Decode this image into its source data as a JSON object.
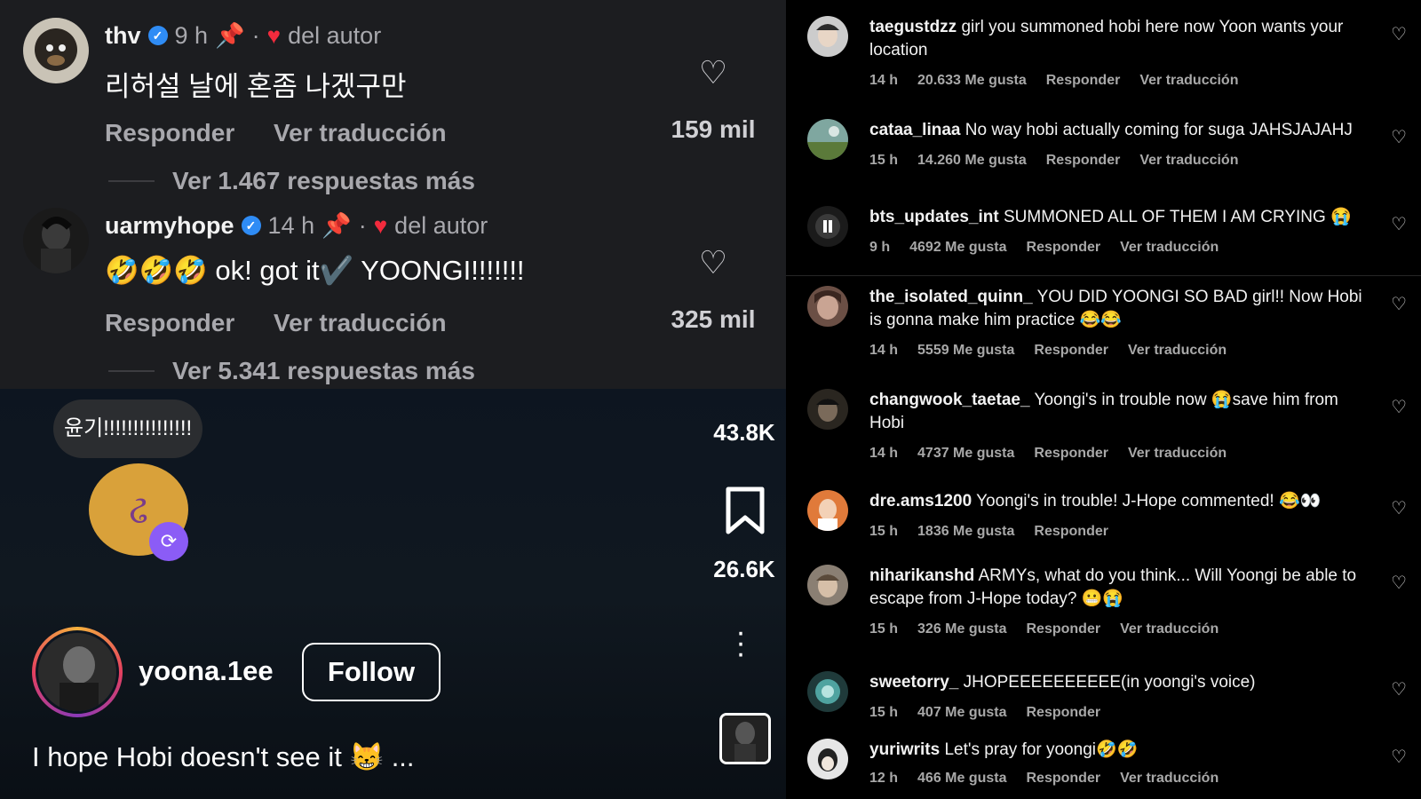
{
  "left_panel": {
    "comments": [
      {
        "username": "thv",
        "time": "9 h",
        "by_author": "del autor",
        "text": "리허설 날에 혼좀 나겠구만",
        "reply": "Responder",
        "translate": "Ver traducción",
        "likes": "159 mil",
        "more_replies": "Ver 1.467 respuestas más"
      },
      {
        "username": "uarmyhope",
        "time": "14 h",
        "by_author": "del autor",
        "text": "🤣🤣🤣 ok! got it✔️ YOONGI!!!!!!!",
        "reply": "Responder",
        "translate": "Ver traducción",
        "likes": "325 mil",
        "more_replies": "Ver 5.341 respuestas más"
      }
    ],
    "video": {
      "bubble_text": "윤기!!!!!!!!!!!!!!!",
      "like_count": "43.8K",
      "save_count": "26.6K",
      "profile_name": "yoona.1ee",
      "follow_label": "Follow",
      "caption": "I hope Hobi doesn't see it 😸 ..."
    }
  },
  "right_panel": {
    "comments": [
      {
        "username": "taegustdzz",
        "text": "girl you summoned hobi here now Yoon wants your location",
        "time": "14 h",
        "likes": "20.633 Me gusta",
        "reply": "Responder",
        "translate": "Ver traducción"
      },
      {
        "username": "cataa_linaa",
        "text": "No way hobi actually coming for suga JAHSJAJAHJ",
        "time": "15 h",
        "likes": "14.260 Me gusta",
        "reply": "Responder",
        "translate": "Ver traducción"
      },
      {
        "username": "bts_updates_int",
        "text": "SUMMONED ALL OF THEM I AM CRYING 😭",
        "time": "9 h",
        "likes": "4692 Me gusta",
        "reply": "Responder",
        "translate": "Ver traducción"
      },
      {
        "username": "the_isolated_quinn_",
        "text": "YOU DID YOONGI SO BAD girl!! Now Hobi is gonna make him practice 😂😂",
        "time": "14 h",
        "likes": "5559 Me gusta",
        "reply": "Responder",
        "translate": "Ver traducción"
      },
      {
        "username": "changwook_taetae_",
        "text": "Yoongi's in trouble now 😭save him from Hobi",
        "time": "14 h",
        "likes": "4737 Me gusta",
        "reply": "Responder",
        "translate": "Ver traducción"
      },
      {
        "username": "dre.ams1200",
        "text": "Yoongi's in trouble! J-Hope commented! 😂👀",
        "time": "15 h",
        "likes": "1836 Me gusta",
        "reply": "Responder",
        "translate": ""
      },
      {
        "username": "niharikanshd",
        "text": "ARMYs, what do you think... Will Yoongi be able to escape from J-Hope today? 😬😭",
        "time": "15 h",
        "likes": "326 Me gusta",
        "reply": "Responder",
        "translate": "Ver traducción"
      },
      {
        "username": "sweetorry_",
        "text": "JHOPEEEEEEEEEE(in yoongi's voice)",
        "time": "15 h",
        "likes": "407 Me gusta",
        "reply": "Responder",
        "translate": ""
      },
      {
        "username": "yuriwrits",
        "text": "Let's pray for yoongi🤣🤣",
        "time": "12 h",
        "likes": "466 Me gusta",
        "reply": "Responder",
        "translate": "Ver traducción"
      }
    ]
  },
  "icons": {
    "heart": "heart-icon",
    "verified": "verified-badge-icon",
    "pin": "pin-icon",
    "bookmark": "bookmark-icon",
    "more": "more-options-icon",
    "repost": "repost-icon"
  },
  "colors": {
    "verified": "#2f8cf5",
    "author_heart": "#f22b3d"
  }
}
